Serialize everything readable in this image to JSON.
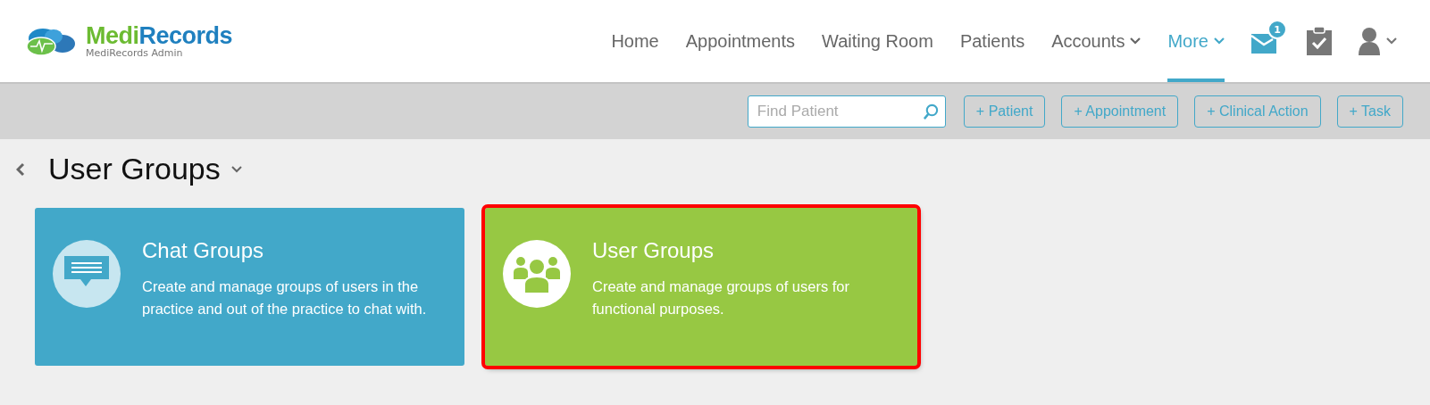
{
  "logo": {
    "brand_part1": "Medi",
    "brand_part2": "Records",
    "subtitle": "MediRecords Admin"
  },
  "nav": [
    {
      "label": "Home",
      "has_caret": false,
      "selected": false
    },
    {
      "label": "Appointments",
      "has_caret": false,
      "selected": false
    },
    {
      "label": "Waiting Room",
      "has_caret": false,
      "selected": false
    },
    {
      "label": "Patients",
      "has_caret": false,
      "selected": false
    },
    {
      "label": "Accounts",
      "has_caret": true,
      "selected": false
    },
    {
      "label": "More",
      "has_caret": true,
      "selected": true
    }
  ],
  "messages_badge": "1",
  "toolbar": {
    "search": {
      "placeholder": "Find Patient"
    },
    "buttons": [
      "+ Patient",
      "+ Appointment",
      "+ Clinical Action",
      "+ Task"
    ]
  },
  "page_title": "User Groups",
  "cards": [
    {
      "kind": "chat",
      "title": "Chat Groups",
      "description": "Create and manage groups of users in the practice and out of the practice to chat with.",
      "color": "#42a8c9",
      "highlighted": false
    },
    {
      "kind": "users",
      "title": "User Groups",
      "description": "Create and manage groups of users for functional purposes.",
      "color": "#97c843",
      "highlighted": true
    }
  ]
}
